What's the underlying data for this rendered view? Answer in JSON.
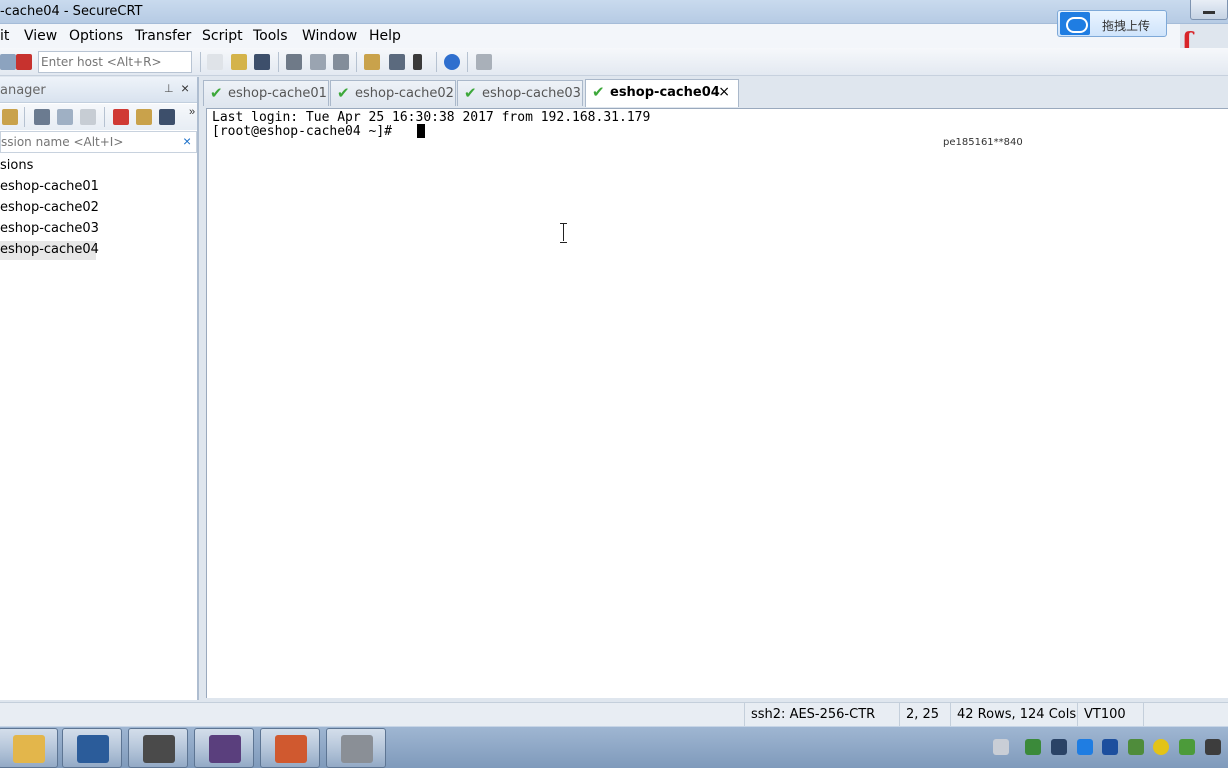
{
  "window": {
    "title": "-cache04 - SecureCRT",
    "cloud_button_label": "拖拽上传"
  },
  "menu": [
    "it",
    "View",
    "Options",
    "Transfer",
    "Script",
    "Tools",
    "Window",
    "Help"
  ],
  "toolbar": {
    "host_placeholder": "Enter host <Alt+R>"
  },
  "session_manager": {
    "title": "anager",
    "search_placeholder": "ssion name <Alt+I>",
    "tree": [
      {
        "label": "sions"
      },
      {
        "label": "eshop-cache01"
      },
      {
        "label": "eshop-cache02"
      },
      {
        "label": "eshop-cache03"
      },
      {
        "label": "eshop-cache04",
        "selected": true
      }
    ]
  },
  "tabs": [
    {
      "label": "eshop-cache01",
      "active": false
    },
    {
      "label": "eshop-cache02",
      "active": false
    },
    {
      "label": "eshop-cache03",
      "active": false
    },
    {
      "label": "eshop-cache04",
      "active": true,
      "close": "×"
    }
  ],
  "terminal": {
    "lines": [
      "Last login: Tue Apr 25 16:30:38 2017 from 192.168.31.179",
      "[root@eshop-cache04 ~]# "
    ],
    "watermark": "pe185161**840"
  },
  "statusbar": {
    "cipher": "ssh2: AES-256-CTR",
    "cursor_pos": "2,  25",
    "size": "42 Rows, 124 Cols",
    "emulation": "VT100"
  },
  "colors": {
    "check": "#3da83a",
    "accent": "#1f7de2",
    "logo": "#d8252a"
  }
}
